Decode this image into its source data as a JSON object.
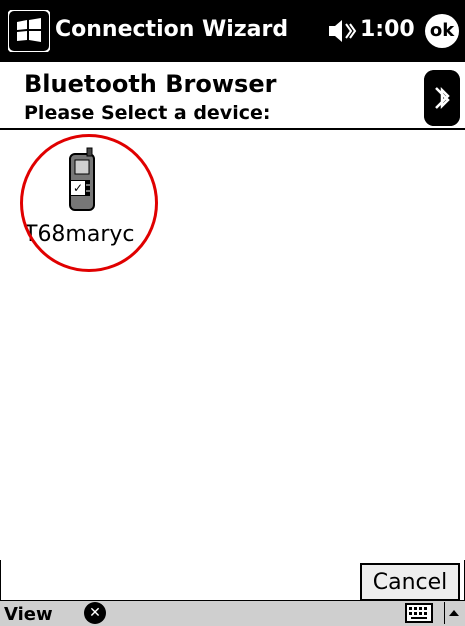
{
  "titlebar": {
    "app_title": "Connection Wizard",
    "time": "1:00",
    "ok_label": "ok"
  },
  "header": {
    "title": "Bluetooth Browser",
    "subtitle": "Please Select a device:"
  },
  "devices": [
    {
      "name": "T68maryc",
      "checked": true
    }
  ],
  "buttons": {
    "cancel_label": "Cancel"
  },
  "menubar": {
    "view_label": "View"
  },
  "icons": {
    "start": "windows-flag-icon",
    "speaker": "speaker-icon",
    "bluetooth": "bluetooth-icon",
    "phone": "mobile-phone-icon",
    "close": "close-icon",
    "keyboard": "keyboard-icon",
    "sip": "arrow-up-icon"
  },
  "colors": {
    "highlight": "#e00000",
    "titlebar_bg": "#000000",
    "menubar_bg": "#cfcfcf"
  }
}
